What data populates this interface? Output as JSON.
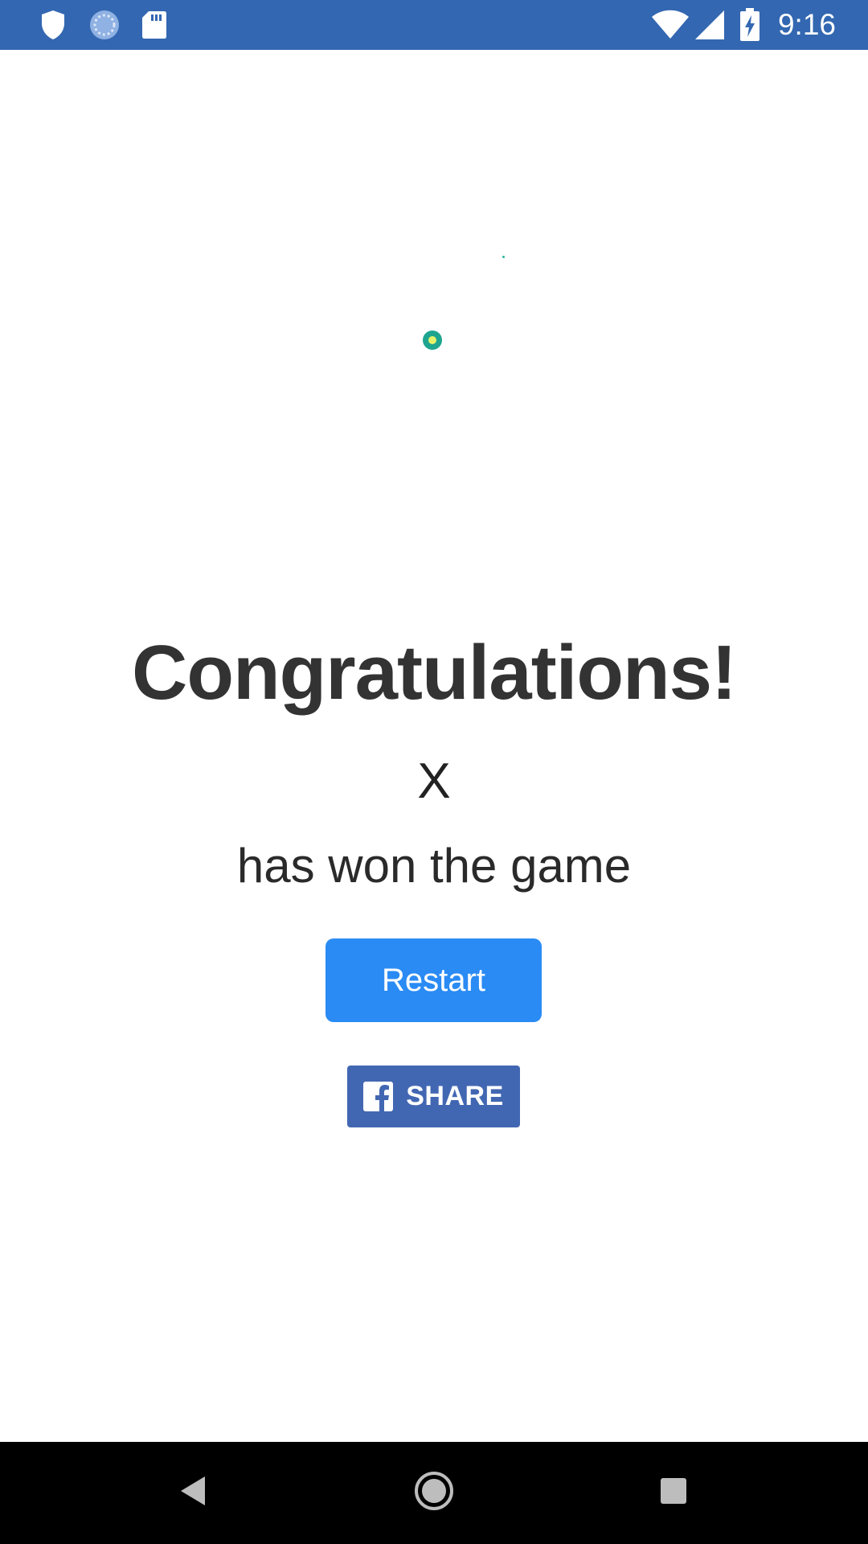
{
  "status_bar": {
    "time": "9:16",
    "background": "#3367b1",
    "icons": [
      "shield-icon",
      "sync-icon",
      "sd-card-icon",
      "wifi-icon",
      "signal-icon",
      "battery-charging-icon"
    ]
  },
  "result": {
    "title": "Congratulations!",
    "winner": "X",
    "subtitle": "has won the game"
  },
  "actions": {
    "restart_label": "Restart",
    "restart_color": "#2a8bf4",
    "share_label": "SHARE",
    "share_color": "#4267b2"
  },
  "nav_bar": {
    "buttons": [
      "back-icon",
      "home-icon",
      "recents-icon"
    ]
  }
}
